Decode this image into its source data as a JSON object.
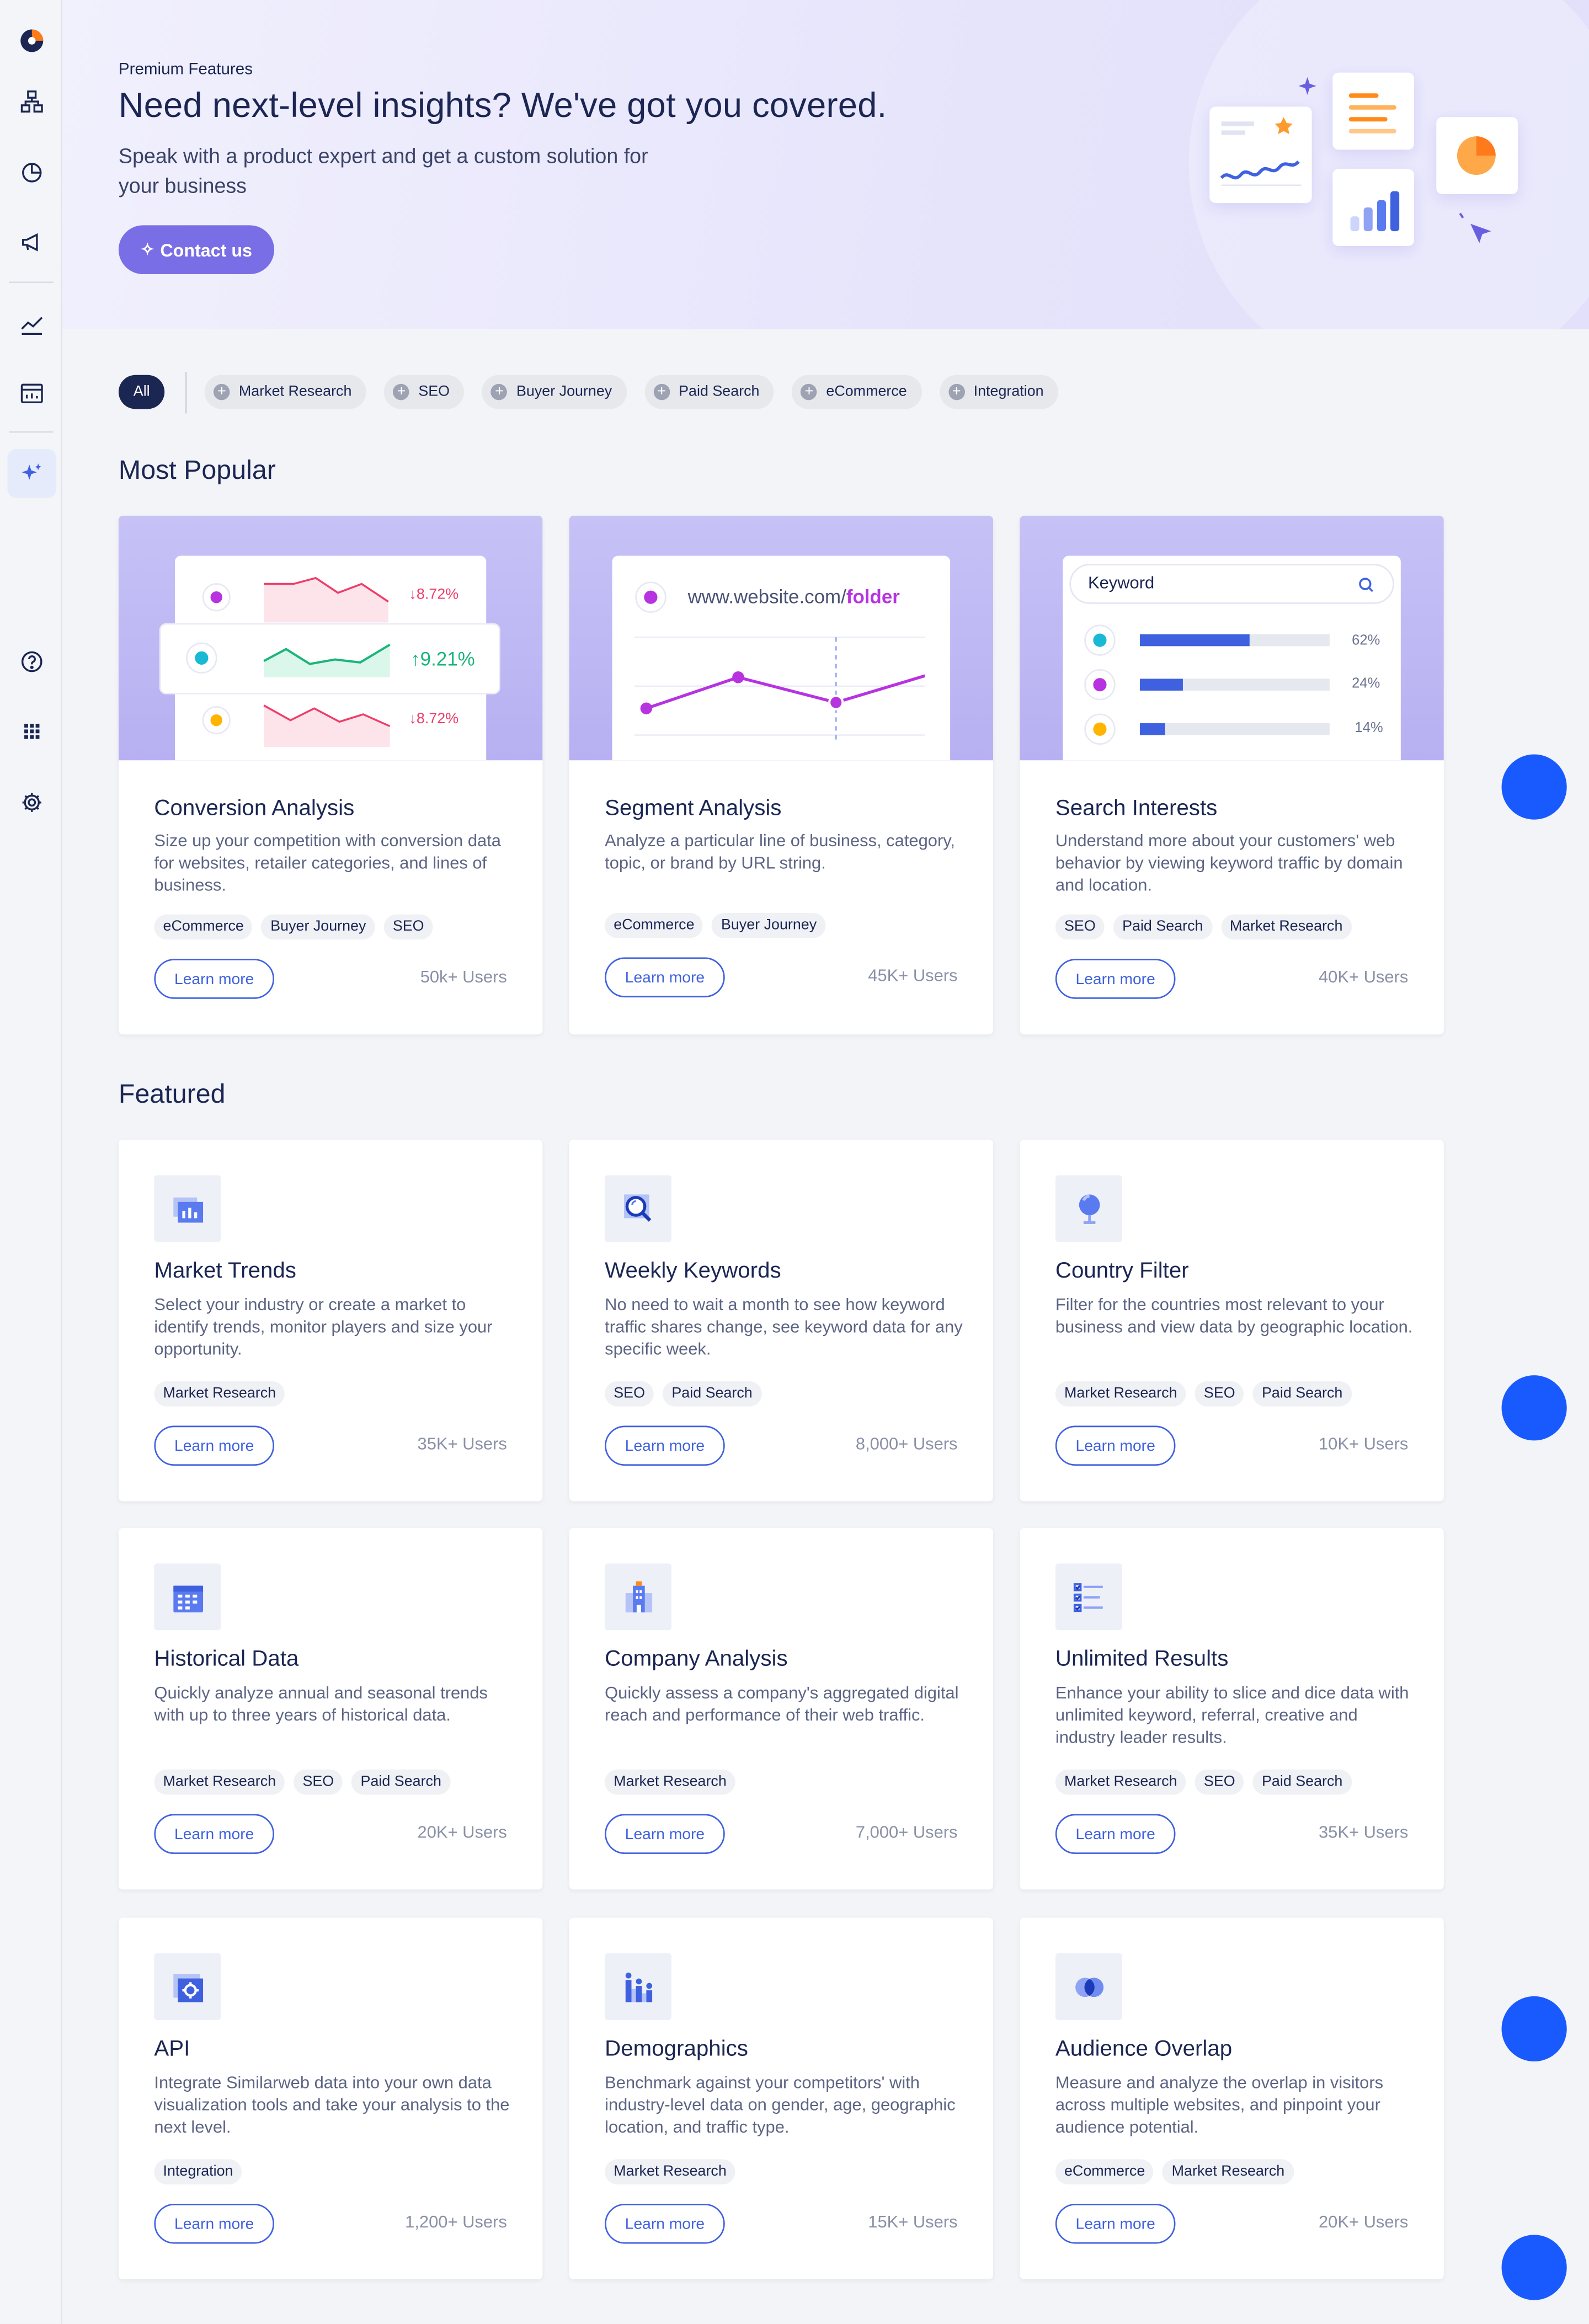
{
  "hero": {
    "kicker": "Premium Features",
    "title": "Need next-level insights? We've got you covered.",
    "subtitle": "Speak with a product expert and get a custom solution for your business",
    "cta": "Contact us"
  },
  "sidebar": {
    "items": [
      "logo-icon",
      "hierarchy-icon",
      "pie-chart-icon",
      "megaphone-icon",
      "trend-icon",
      "dashboard-icon",
      "sparkle-icon",
      "help-icon",
      "apps-grid-icon",
      "settings-icon"
    ]
  },
  "filters": {
    "all": "All",
    "chips": [
      "Market Research",
      "SEO",
      "Buyer Journey",
      "Paid Search",
      "eCommerce",
      "Integration"
    ]
  },
  "sections": {
    "popular": "Most Popular",
    "featured": "Featured"
  },
  "popular": [
    {
      "title": "Conversion Analysis",
      "desc": "Size up your competition with conversion data for websites, retailer categories, and lines of business.",
      "tags": [
        "eCommerce",
        "Buyer Journey",
        "SEO"
      ],
      "learn": "Learn more",
      "users": "50k+ Users",
      "illustration": {
        "rows": [
          "↓8.72%",
          "↑9.21%",
          "↓8.72%"
        ]
      }
    },
    {
      "title": "Segment Analysis",
      "desc": "Analyze a particular line of business, category, topic, or brand by URL string.",
      "tags": [
        "eCommerce",
        "Buyer Journey"
      ],
      "learn": "Learn more",
      "users": "45K+ Users",
      "illustration": {
        "url_prefix": "www.website.com/",
        "url_highlight": "folder"
      }
    },
    {
      "title": "Search Interests",
      "desc": "Understand more about your customers' web behavior by viewing keyword traffic by domain and location.",
      "tags": [
        "SEO",
        "Paid Search",
        "Market Research"
      ],
      "learn": "Learn more",
      "users": "40K+ Users",
      "illustration": {
        "search_label": "Keyword",
        "bars": [
          {
            "label": "62%",
            "value": 0.62
          },
          {
            "label": "24%",
            "value": 0.24
          },
          {
            "label": "14%",
            "value": 0.14
          }
        ]
      }
    }
  ],
  "featured": [
    {
      "title": "Market Trends",
      "desc": "Select your industry or create a market to identify trends, monitor players and size your opportunity.",
      "tags": [
        "Market Research"
      ],
      "learn": "Learn more",
      "users": "35K+ Users",
      "icon": "market-trends-icon"
    },
    {
      "title": "Weekly Keywords",
      "desc": "No need to wait a month to see how keyword traffic shares change, see keyword data for any specific week.",
      "tags": [
        "SEO",
        "Paid Search"
      ],
      "learn": "Learn more",
      "users": "8,000+ Users",
      "icon": "keyword-search-icon"
    },
    {
      "title": "Country Filter",
      "desc": "Filter for the countries most relevant to your business and view data by geographic location.",
      "tags": [
        "Market Research",
        "SEO",
        "Paid Search"
      ],
      "learn": "Learn more",
      "users": "10K+ Users",
      "icon": "globe-icon"
    },
    {
      "title": "Historical Data",
      "desc": "Quickly analyze annual and seasonal trends with up to three years of historical data.",
      "tags": [
        "Market Research",
        "SEO",
        "Paid Search"
      ],
      "learn": "Learn more",
      "users": "20K+ Users",
      "icon": "calendar-icon"
    },
    {
      "title": "Company Analysis",
      "desc": "Quickly assess a company's aggregated digital reach and performance of their web traffic.",
      "tags": [
        "Market Research"
      ],
      "learn": "Learn more",
      "users": "7,000+ Users",
      "icon": "building-icon"
    },
    {
      "title": "Unlimited Results",
      "desc": "Enhance your ability to slice and dice data with unlimited keyword, referral, creative and industry leader results.",
      "tags": [
        "Market Research",
        "SEO",
        "Paid Search"
      ],
      "learn": "Learn more",
      "users": "35K+ Users",
      "icon": "checklist-icon"
    },
    {
      "title": "API",
      "desc": "Integrate Similarweb data into your own data visualization tools and take your analysis to the next level.",
      "tags": [
        "Integration"
      ],
      "learn": "Learn more",
      "users": "1,200+ Users",
      "icon": "api-gear-icon"
    },
    {
      "title": "Demographics",
      "desc": "Benchmark against your competitors' with industry-level data on gender, age, geographic location, and traffic type.",
      "tags": [
        "Market Research"
      ],
      "learn": "Learn more",
      "users": "15K+ Users",
      "icon": "people-bars-icon"
    },
    {
      "title": "Audience Overlap",
      "desc": "Measure and analyze the overlap in visitors across multiple websites, and pinpoint your audience potential.",
      "tags": [
        "eCommerce",
        "Market Research"
      ],
      "learn": "Learn more",
      "users": "20K+ Users",
      "icon": "overlap-circles-icon"
    }
  ],
  "colors": {
    "accent": "#3f61e0",
    "brand_navy": "#1b2653",
    "cta": "#7a6ee6",
    "fab": "#195afe"
  }
}
